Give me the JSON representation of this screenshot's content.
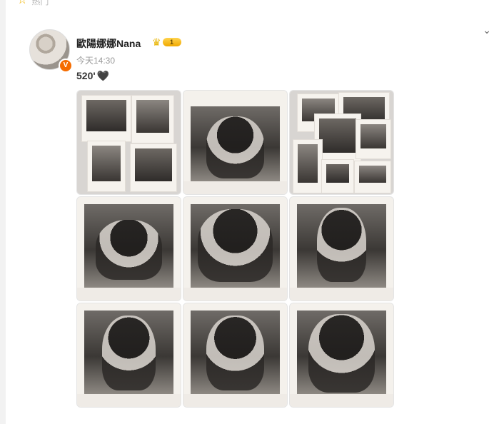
{
  "header": {
    "partial_label": "热门"
  },
  "post": {
    "user_name": "歐陽娜娜Nana",
    "time": "今天14:30",
    "text": "520'",
    "emoji": "🖤",
    "vip_level": "1"
  },
  "images": {
    "tiles": [
      {
        "name": "tile-1"
      },
      {
        "name": "tile-2"
      },
      {
        "name": "tile-3"
      },
      {
        "name": "tile-4"
      },
      {
        "name": "tile-5"
      },
      {
        "name": "tile-6"
      },
      {
        "name": "tile-7"
      },
      {
        "name": "tile-8"
      },
      {
        "name": "tile-9"
      }
    ]
  },
  "colors": {
    "accent": "#f56c00",
    "vip_gold": "#f0a800",
    "text_primary": "#222222",
    "text_secondary": "#9a9a9a"
  }
}
